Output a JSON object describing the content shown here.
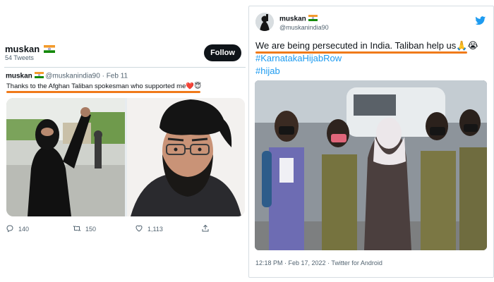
{
  "left_panel": {
    "profile_name": "muskan",
    "tweet_count": "54 Tweets",
    "follow_label": "Follow",
    "tweet": {
      "name": "muskan",
      "handle": "@muskanindia90",
      "separator": "·",
      "date": "Feb 11",
      "text": "Thanks to the Afghan Taliban spokesman who supported me❤️😇",
      "images": [
        {
          "icon": "hijab-woman-protest-photo"
        },
        {
          "icon": "taliban-spokesman-photo"
        }
      ],
      "actions": {
        "replies": "140",
        "retweets": "150",
        "likes": "1,113"
      }
    }
  },
  "right_panel": {
    "name": "muskan",
    "handle": "@muskanindia90",
    "text": "We are being persecuted in India. Taliban help us🙏😭",
    "hashtags": [
      "#KarnatakaHijabRow",
      "#hijab"
    ],
    "image": {
      "icon": "schoolgirls-walking-photo"
    },
    "meta": "12:18 PM · Feb 17, 2022 · Twitter for Android"
  },
  "colors": {
    "highlight_underline": "#f07a1a",
    "link_blue": "#1d9bf0",
    "twitter_blue": "#1d9bf0",
    "follow_button_bg": "#0f1419",
    "muted_text": "#536471"
  }
}
